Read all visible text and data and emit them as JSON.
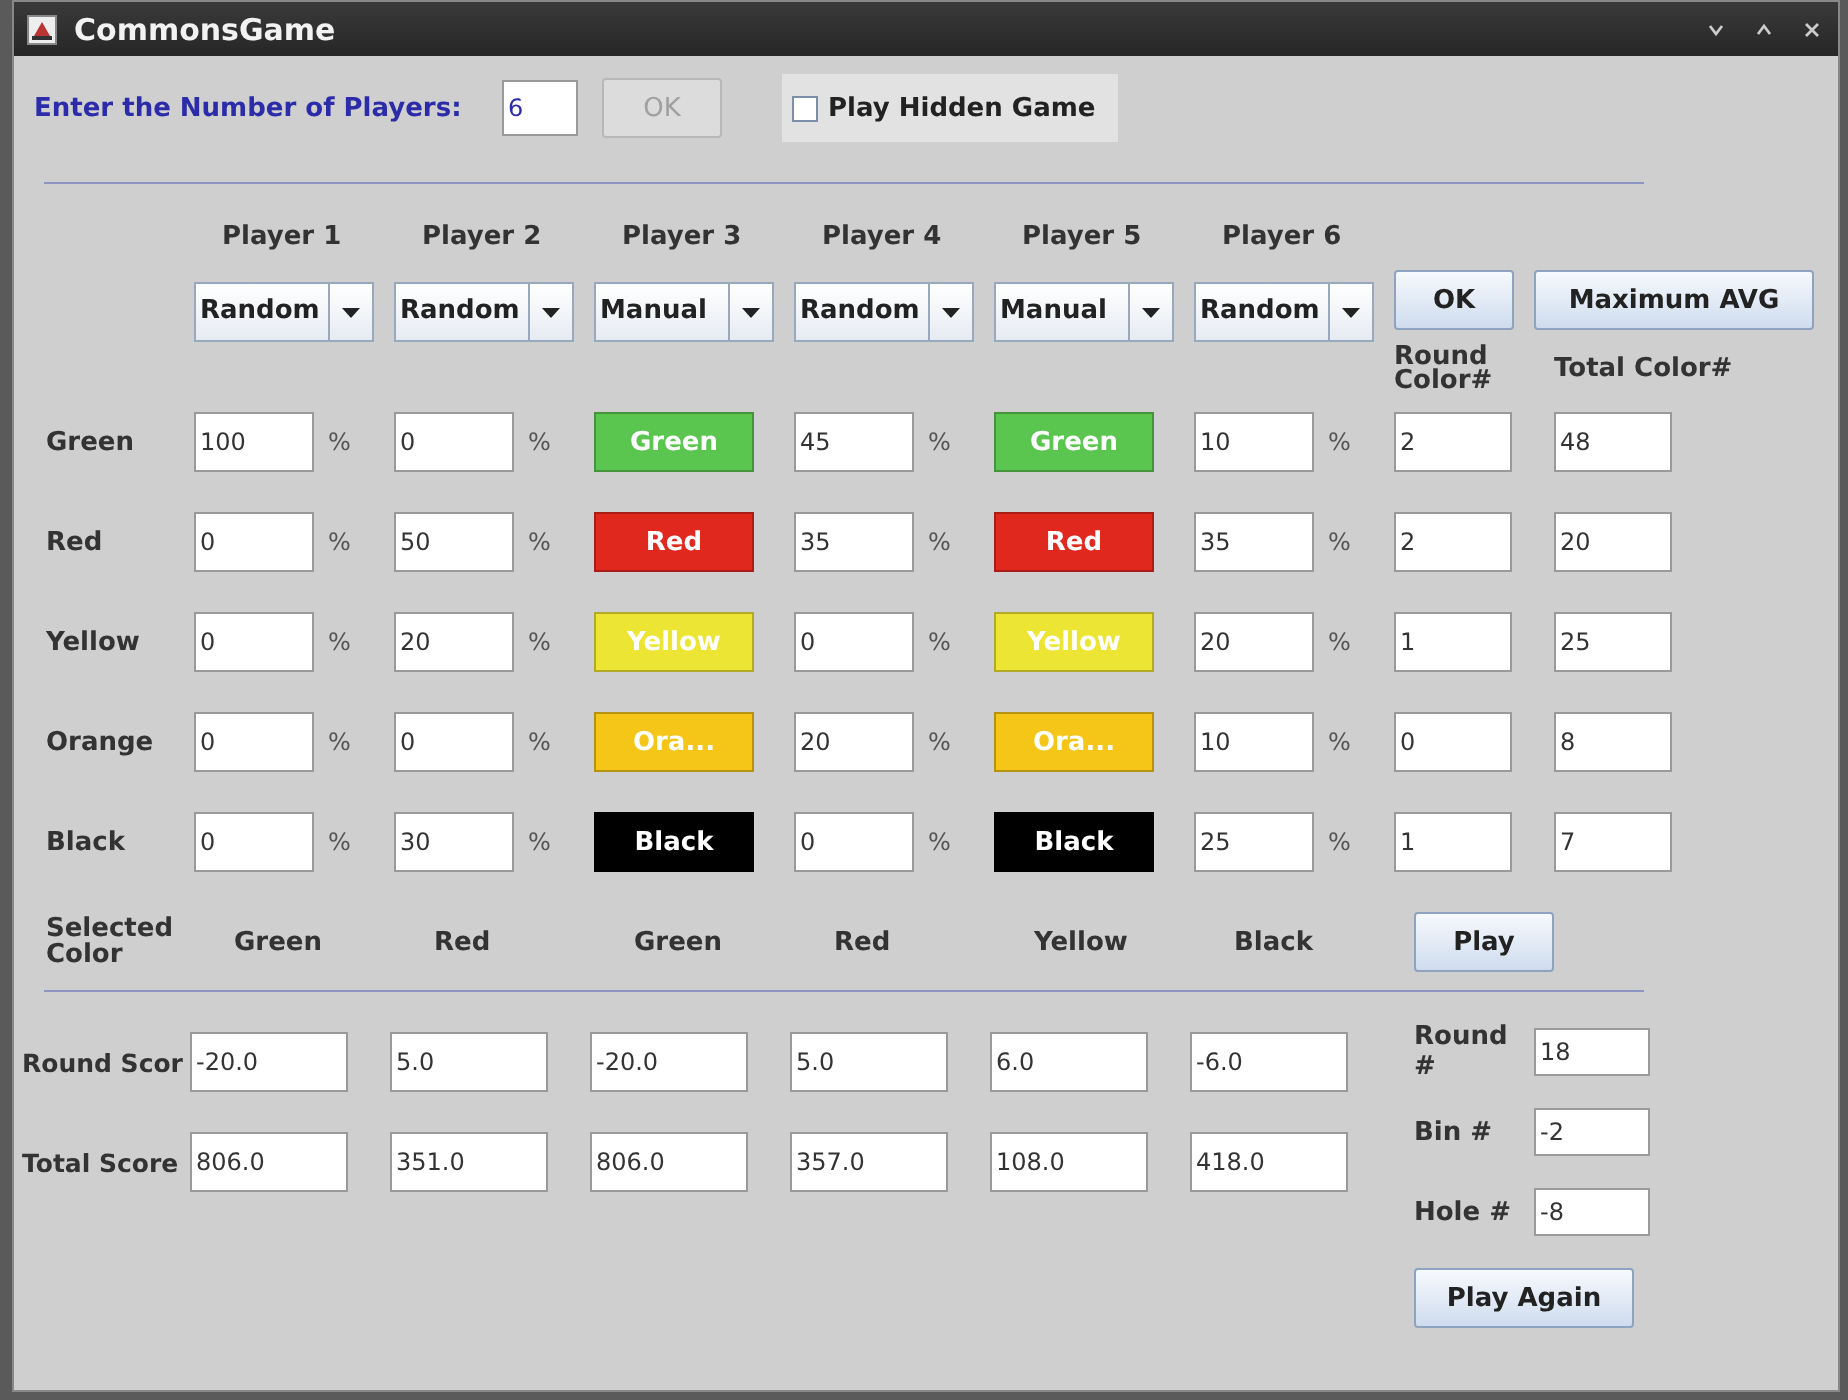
{
  "window": {
    "title": "CommonsGame"
  },
  "setup": {
    "label": "Enter the Number of Players:",
    "players_value": "6",
    "ok_button": {
      "label": "OK",
      "disabled": true
    },
    "hidden_game": {
      "label": "Play Hidden Game",
      "checked": false
    }
  },
  "players": [
    {
      "name": "Player 1",
      "mode": "Random"
    },
    {
      "name": "Player 2",
      "mode": "Random"
    },
    {
      "name": "Player 3",
      "mode": "Manual"
    },
    {
      "name": "Player 4",
      "mode": "Random"
    },
    {
      "name": "Player 5",
      "mode": "Manual"
    },
    {
      "name": "Player 6",
      "mode": "Random"
    }
  ],
  "ok_button": "OK",
  "max_avg_button": "Maximum AVG",
  "round_color_header": "Round Color#",
  "total_color_header": "Total Color#",
  "color_rows": [
    {
      "label": "Green",
      "round_color": "2",
      "total_color": "48",
      "cells": [
        {
          "kind": "field",
          "value": "100",
          "unit": "%"
        },
        {
          "kind": "field",
          "value": "0",
          "unit": "%"
        },
        {
          "kind": "color-button",
          "label": "Green",
          "color": "#5bc64f"
        },
        {
          "kind": "field",
          "value": "45",
          "unit": "%"
        },
        {
          "kind": "color-button",
          "label": "Green",
          "color": "#5bc64f"
        },
        {
          "kind": "field",
          "value": "10",
          "unit": "%"
        }
      ]
    },
    {
      "label": "Red",
      "round_color": "2",
      "total_color": "20",
      "cells": [
        {
          "kind": "field",
          "value": "0",
          "unit": "%"
        },
        {
          "kind": "field",
          "value": "50",
          "unit": "%"
        },
        {
          "kind": "color-button",
          "label": "Red",
          "color": "#e0281f"
        },
        {
          "kind": "field",
          "value": "35",
          "unit": "%"
        },
        {
          "kind": "color-button",
          "label": "Red",
          "color": "#e0281f"
        },
        {
          "kind": "field",
          "value": "35",
          "unit": "%"
        }
      ]
    },
    {
      "label": "Yellow",
      "round_color": "1",
      "total_color": "25",
      "cells": [
        {
          "kind": "field",
          "value": "0",
          "unit": "%"
        },
        {
          "kind": "field",
          "value": "20",
          "unit": "%"
        },
        {
          "kind": "color-button",
          "label": "Yellow",
          "color": "#ece534"
        },
        {
          "kind": "field",
          "value": "0",
          "unit": "%"
        },
        {
          "kind": "color-button",
          "label": "Yellow",
          "color": "#ece534"
        },
        {
          "kind": "field",
          "value": "20",
          "unit": "%"
        }
      ]
    },
    {
      "label": "Orange",
      "round_color": "0",
      "total_color": "8",
      "cells": [
        {
          "kind": "field",
          "value": "0",
          "unit": "%"
        },
        {
          "kind": "field",
          "value": "0",
          "unit": "%"
        },
        {
          "kind": "color-button",
          "label": "Ora...",
          "color": "#f5c518"
        },
        {
          "kind": "field",
          "value": "20",
          "unit": "%"
        },
        {
          "kind": "color-button",
          "label": "Ora...",
          "color": "#f5c518"
        },
        {
          "kind": "field",
          "value": "10",
          "unit": "%"
        }
      ]
    },
    {
      "label": "Black",
      "round_color": "1",
      "total_color": "7",
      "cells": [
        {
          "kind": "field",
          "value": "0",
          "unit": "%"
        },
        {
          "kind": "field",
          "value": "30",
          "unit": "%"
        },
        {
          "kind": "color-button",
          "label": "Black",
          "color": "#000000"
        },
        {
          "kind": "field",
          "value": "0",
          "unit": "%"
        },
        {
          "kind": "color-button",
          "label": "Black",
          "color": "#000000"
        },
        {
          "kind": "field",
          "value": "25",
          "unit": "%"
        }
      ]
    }
  ],
  "selected_color": {
    "label": "Selected Color",
    "values": [
      "Green",
      "Red",
      "Green",
      "Red",
      "Yellow",
      "Black"
    ]
  },
  "play_button": "Play",
  "score_rows": [
    {
      "label": "Round Scor",
      "values": [
        "-20.0",
        "5.0",
        "-20.0",
        "5.0",
        "6.0",
        "-6.0"
      ]
    },
    {
      "label": "Total Score",
      "values": [
        "806.0",
        "351.0",
        "806.0",
        "357.0",
        "108.0",
        "418.0"
      ]
    }
  ],
  "round_info": [
    {
      "label": "Round #",
      "value": "18"
    },
    {
      "label": "Bin #",
      "value": "-2"
    },
    {
      "label": "Hole #",
      "value": "-8"
    }
  ],
  "play_again_button": "Play Again"
}
